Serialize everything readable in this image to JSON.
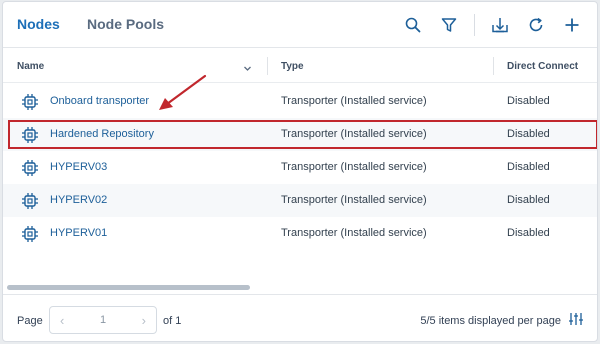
{
  "header": {
    "tabs": [
      {
        "label": "Nodes",
        "active": true
      },
      {
        "label": "Node Pools",
        "active": false
      }
    ],
    "toolbar_icons": [
      "search-icon",
      "filter-icon",
      "download-icon",
      "refresh-icon",
      "add-icon"
    ]
  },
  "table": {
    "columns": [
      "Name",
      "Type",
      "Direct Connect"
    ],
    "rows": [
      {
        "name": "Onboard transporter",
        "type": "Transporter (Installed service)",
        "direct_connect": "Disabled"
      },
      {
        "name": "Hardened Repository",
        "type": "Transporter (Installed service)",
        "direct_connect": "Disabled",
        "highlighted": true
      },
      {
        "name": "HYPERV03",
        "type": "Transporter (Installed service)",
        "direct_connect": "Disabled"
      },
      {
        "name": "HYPERV02",
        "type": "Transporter (Installed service)",
        "direct_connect": "Disabled"
      },
      {
        "name": "HYPERV01",
        "type": "Transporter (Installed service)",
        "direct_connect": "Disabled"
      }
    ]
  },
  "footer": {
    "page_label": "Page",
    "current_page": "1",
    "of_label": "of 1",
    "items_label": "5/5 items displayed per page"
  },
  "colors": {
    "accent": "#1d6fb8",
    "highlight_border": "#c1272d",
    "annotation_arrow": "#c1272d"
  }
}
